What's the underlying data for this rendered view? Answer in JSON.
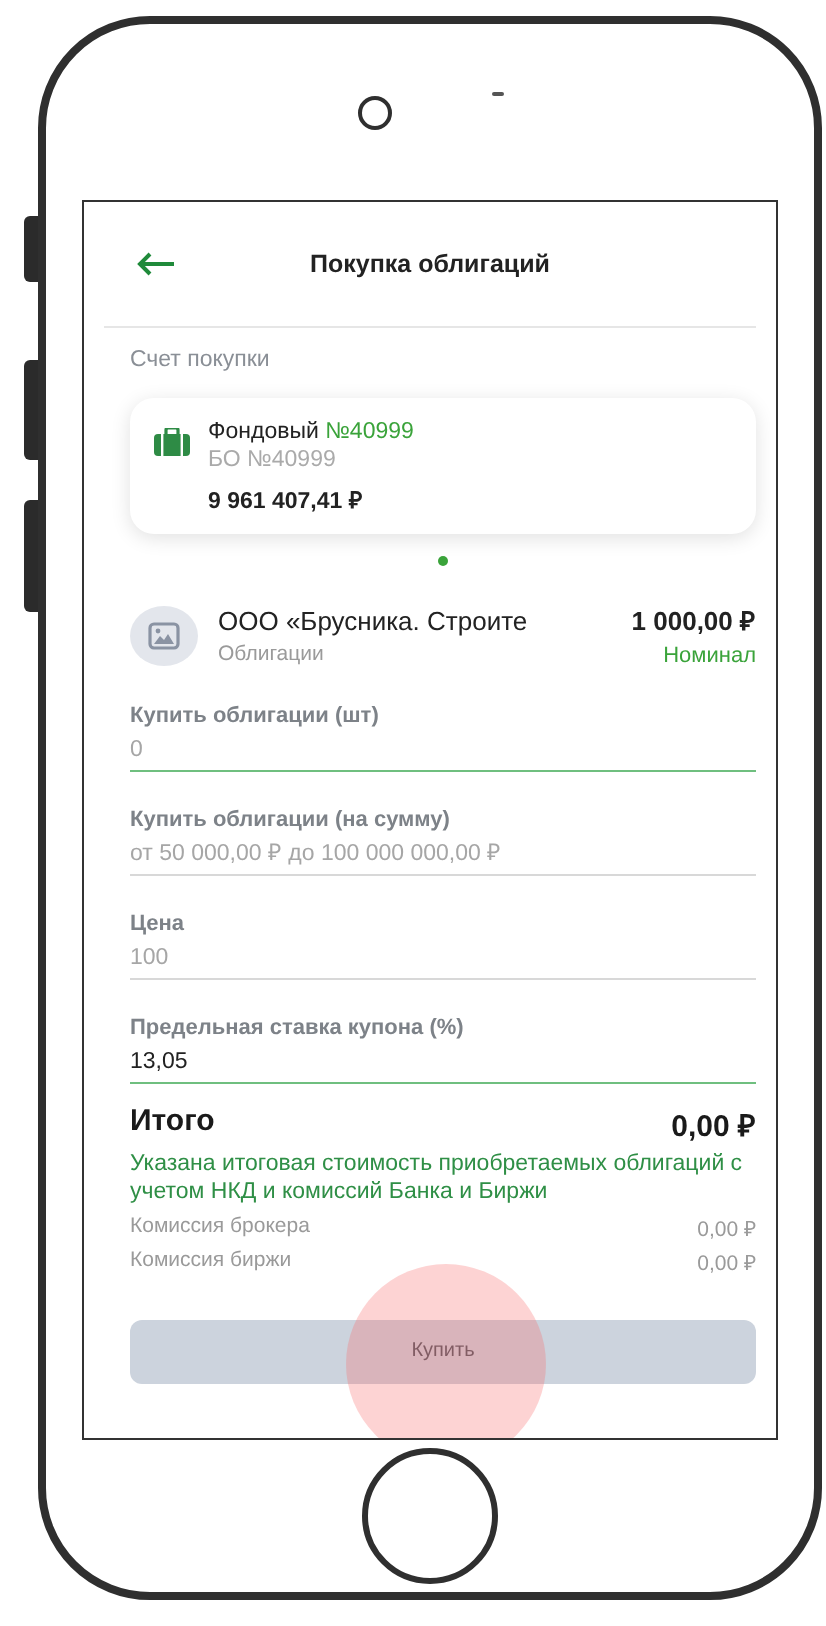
{
  "header": {
    "title": "Покупка облигаций"
  },
  "account_section": {
    "label": "Счет покупки"
  },
  "account": {
    "name": "Фондовый",
    "number": "№40999",
    "subtitle": "БО №40999",
    "balance": "9 961 407,41 ₽"
  },
  "bond": {
    "name": "ООО «Брусника. Строите",
    "type": "Облигации",
    "price": "1 000,00 ₽",
    "price_label": "Номинал"
  },
  "fields": [
    {
      "label": "Купить облигации (шт)",
      "placeholder": "0",
      "active": true
    },
    {
      "label": "Купить облигации (на сумму)",
      "placeholder": "от 50 000,00 ₽ до 100 000 000,00 ₽",
      "active": false
    },
    {
      "label": "Цена",
      "placeholder": "100",
      "active": false
    },
    {
      "label": "Предельная ставка купона (%)",
      "value": "13,05",
      "active": true
    }
  ],
  "total": {
    "label": "Итого",
    "value": "0,00 ₽",
    "note": "Указана итоговая стоимость приобретаемых облигаций с учетом НКД и комиссий Банка и Биржи"
  },
  "commissions": [
    {
      "label": "Комиссия брокера",
      "value": "0,00 ₽"
    },
    {
      "label": "Комиссия биржи",
      "value": "0,00 ₽"
    }
  ],
  "buy_button": {
    "label": "Купить",
    "disabled": true
  }
}
